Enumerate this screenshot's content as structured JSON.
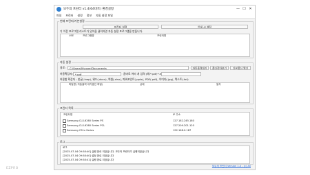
{
  "window": {
    "title": "모두의 프린터 v1.4(64비트) 환경설정",
    "minimize": "—",
    "maximize": "☐",
    "close": "✕"
  },
  "menu": [
    "파일",
    "프린터",
    "설정",
    "정보",
    "자동 설정 파일"
  ],
  "printer_group": {
    "label": "현재 프린터/기본설정",
    "printer_button": "프린터 설정",
    "printer_settings_button": "인쇄 시 설정",
    "info_text": "기 이전 프로그램 리스트가 있어을 클릭하면 자동 설정 프로그램을 만듭니다.",
    "columns": [
      "USE",
      "프로그램명",
      "프린터명"
    ]
  },
  "auto_group": {
    "label": "자동 설정",
    "path_label": "경로:",
    "path_value": "C:\\Users\\Myuser\\Documents",
    "add_button": "자동출력대기",
    "save_button": "폴더찾아보기",
    "default_button": "기본폴더 열기",
    "ext_label": "허용확장자:",
    "ext_value": "*.pdf",
    "ext_hint": "콤마로 여러 개 입력 (예:*.pdf;*.hwp)",
    "types_text": "허용할 확장자 : 한글(.hwp), 워드(.docx), 엑셀(.xlsx), 파워포인트(.pptx), PDF(.pdf), 이미지(.jpg), 텍스트(.txt)",
    "list_columns": [
      "파일명 (자동출력 대기중인 파일)",
      "상태",
      "일자"
    ]
  },
  "printer_list": {
    "label": "프린터 목록",
    "columns": [
      "프린터명",
      "IP 주소"
    ],
    "rows": [
      {
        "name": "Samsung CLX-6260 Series PS",
        "ip": "127.182.245.180"
      },
      {
        "name": "Samsung CLX-6260 Series PCL",
        "ip": "127.209.201.120"
      },
      {
        "name": "Samsung C51x Series",
        "ip": "192.168.0.187"
      }
    ]
  },
  "log": {
    "label": "로그",
    "header": "로그",
    "lines": [
      "[2025-07-04 09:58:40] 실행 완료 되었습니다. 모두의 프린터가 실행되었습니다",
      "[2025-07-04 09:58:40] 설정 완료 되었습니다",
      "[2025-07-04 09:58:41] 실행 완료 되었습니다"
    ]
  },
  "footer_link": "모두의 프린터 Version 1.4 - (c) All",
  "watermark": "EZPRO"
}
